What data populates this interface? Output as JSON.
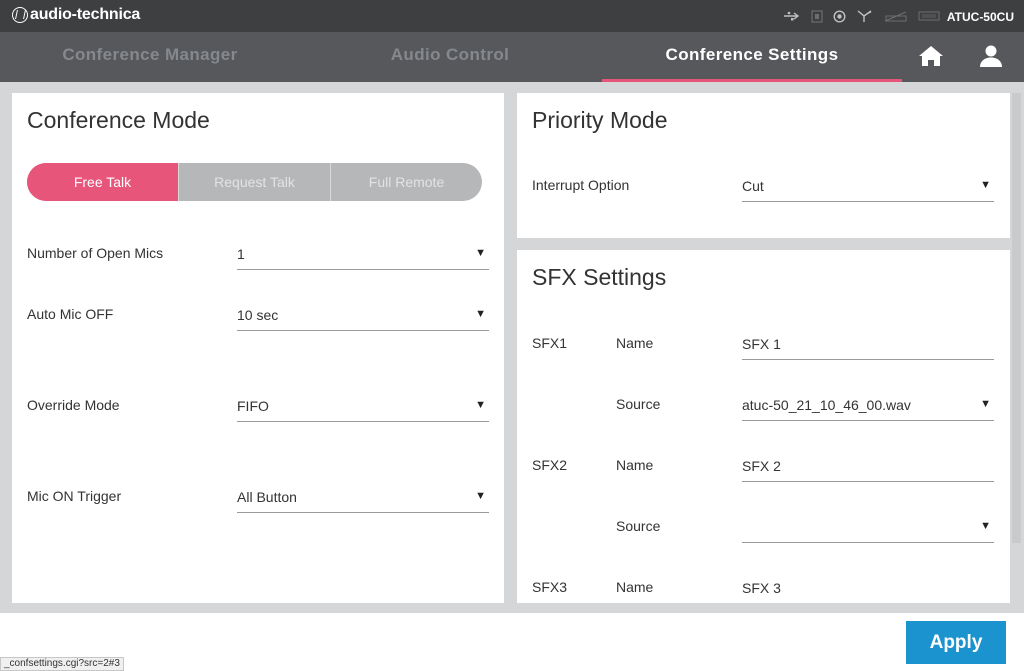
{
  "header": {
    "brand": "audio-technica",
    "device": "ATUC-50CU",
    "status_icons": [
      "usb-icon",
      "sd-card-icon",
      "record-icon",
      "network-icon",
      "battery-icon",
      "signal-icon"
    ]
  },
  "nav": {
    "tabs": [
      {
        "label": "Conference Manager",
        "active": false
      },
      {
        "label": "Audio Control",
        "active": false
      },
      {
        "label": "Conference Settings",
        "active": true
      }
    ],
    "icons": [
      "home-icon",
      "user-icon"
    ]
  },
  "conference_mode": {
    "title": "Conference Mode",
    "segments": [
      "Free Talk",
      "Request Talk",
      "Full Remote"
    ],
    "active_segment": "Free Talk",
    "fields": {
      "open_mics": {
        "label": "Number of Open Mics",
        "value": "1"
      },
      "auto_off": {
        "label": "Auto Mic OFF",
        "value": "10 sec"
      },
      "override": {
        "label": "Override Mode",
        "value": "FIFO"
      },
      "trigger": {
        "label": "Mic ON Trigger",
        "value": "All Button"
      }
    }
  },
  "priority_mode": {
    "title": "Priority Mode",
    "interrupt": {
      "label": "Interrupt Option",
      "value": "Cut"
    }
  },
  "sfx": {
    "title": "SFX Settings",
    "name_label": "Name",
    "source_label": "Source",
    "items": [
      {
        "label": "SFX1",
        "name": "SFX 1",
        "source": "atuc-50_21_10_46_00.wav"
      },
      {
        "label": "SFX2",
        "name": "SFX 2",
        "source": ""
      },
      {
        "label": "SFX3",
        "name": "SFX 3"
      }
    ]
  },
  "footer": {
    "apply": "Apply",
    "status_url": "_confsettings.cgi?src=2#3"
  },
  "colors": {
    "accent": "#e8557a",
    "apply": "#1a93cf",
    "topbar": "#3e3f41",
    "navbar": "#56585b"
  }
}
